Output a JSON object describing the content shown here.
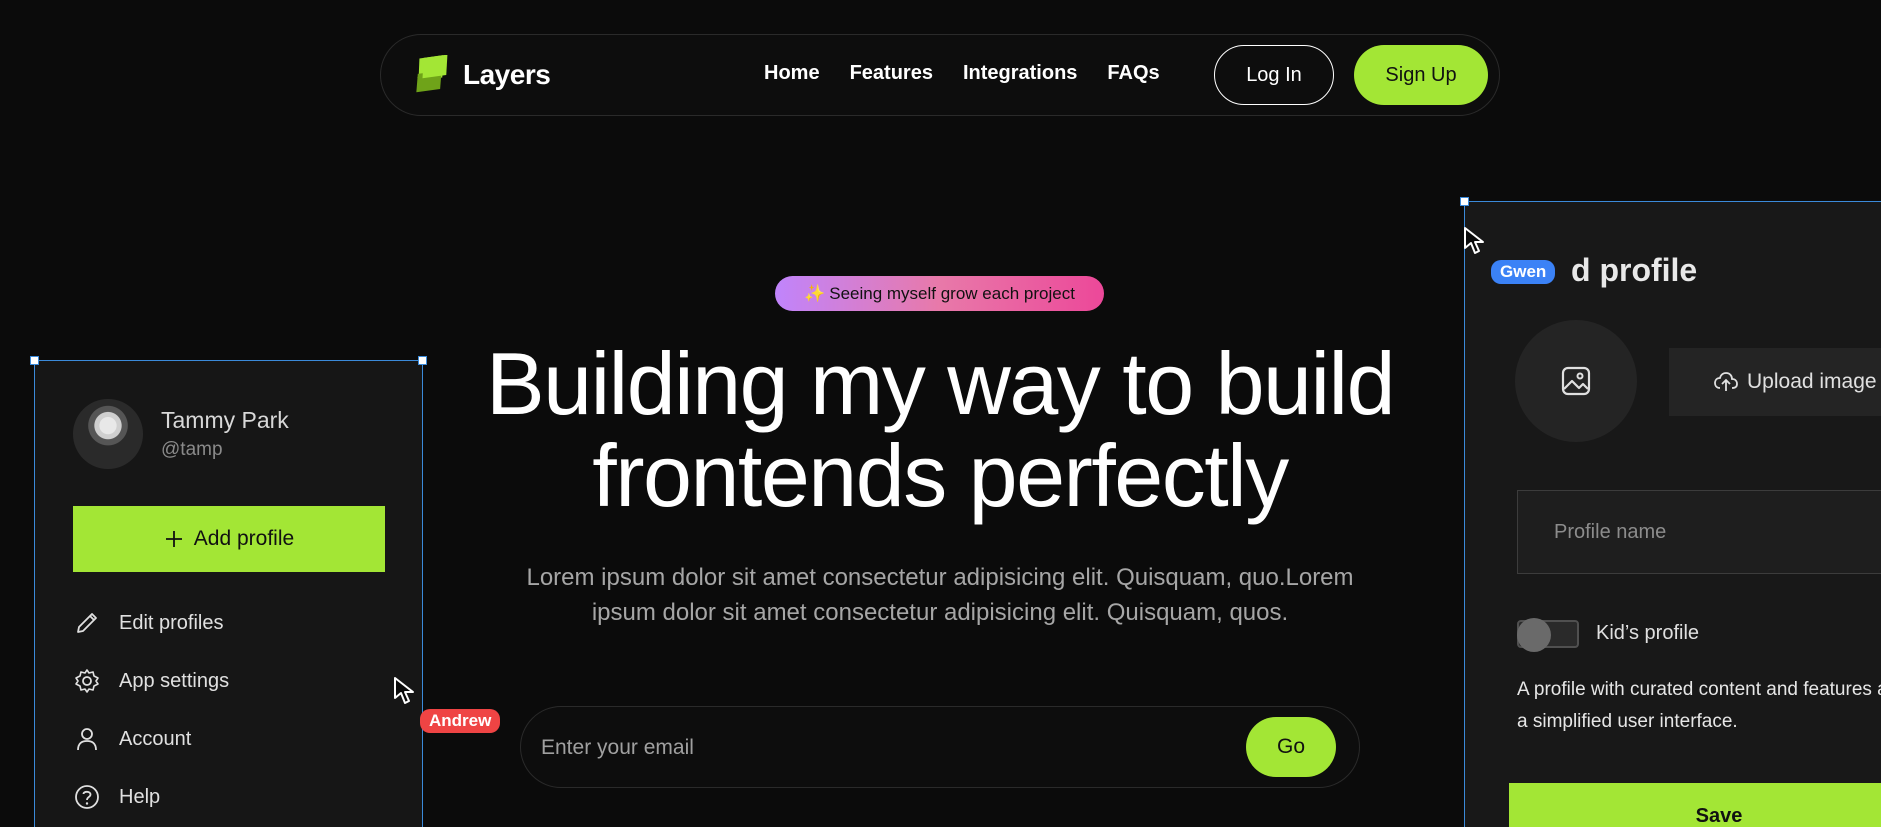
{
  "nav": {
    "brand": "Layers",
    "links": [
      "Home",
      "Features",
      "Integrations",
      "FAQs"
    ],
    "login_label": "Log In",
    "signup_label": "Sign Up"
  },
  "hero": {
    "badge_icon": "✨",
    "badge_text": "Seeing myself grow each project",
    "title_line1": "Building my way to build",
    "title_line2": "frontends perfectly",
    "subtitle": "Lorem ipsum dolor sit amet consectetur adipisicing elit. Quisquam, quo.Lorem ipsum dolor sit amet consectetur adipisicing elit. Quisquam, quos.",
    "email_placeholder": "Enter your email",
    "go_label": "Go"
  },
  "left_panel": {
    "user_name": "Tammy Park",
    "user_handle": "@tamp",
    "add_profile_label": "Add profile",
    "menu": [
      "Edit profiles",
      "App settings",
      "Account",
      "Help"
    ]
  },
  "right_panel": {
    "title": "d profile",
    "upload_label": "Upload image",
    "profile_name_placeholder": "Profile name",
    "kids_toggle_label": "Kid’s profile",
    "kids_toggle_on": false,
    "description": "A profile with curated content and features and a simplified user interface.",
    "save_label": "Save"
  },
  "collaborators": [
    {
      "name": "Gwen",
      "color": "#3b82f6"
    },
    {
      "name": "Andrew",
      "color": "#ef4444"
    }
  ],
  "colors": {
    "background": "#0b0b0b",
    "accent": "#a3e635",
    "selection": "#3b8ad9"
  }
}
